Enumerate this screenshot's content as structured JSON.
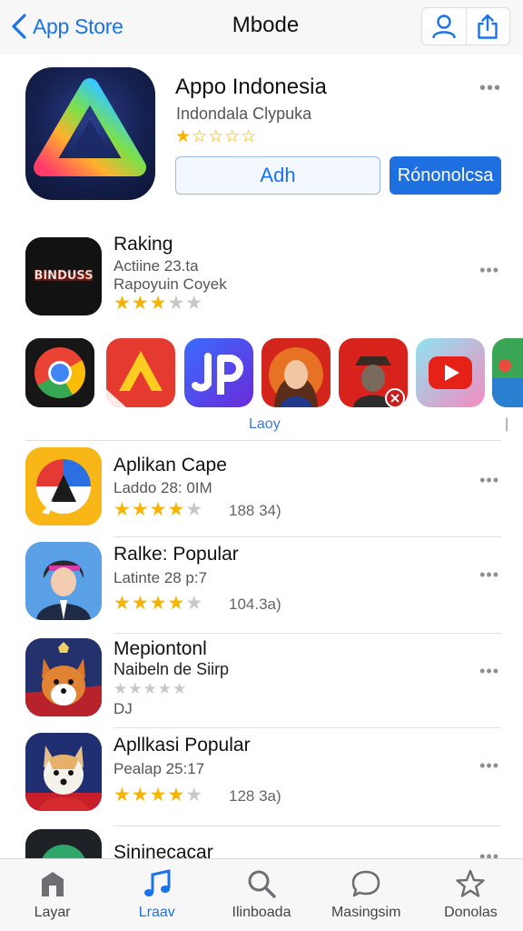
{
  "nav": {
    "back_label": "App Store",
    "title": "Mbode",
    "actions": [
      "account-icon",
      "share-icon"
    ]
  },
  "featured": {
    "name": "Appo Indonesia",
    "subtitle": "Indondala Clypuka",
    "rating": 1,
    "stars_total": 5,
    "stars_text": "★☆☆☆☆",
    "more": "•••",
    "primary_button": "Adh",
    "secondary_button": "Rónonolcsa"
  },
  "ranking": {
    "icon_text": "BINDUSS",
    "name": "Raking",
    "line1": "Actiine 23.ta",
    "line2": "Rapoyuin Coyek",
    "stars_on": "★★★",
    "stars_off": "★★",
    "more": "•••"
  },
  "strip": {
    "label": "Laoy",
    "tick": "|",
    "apps": [
      "chrome-icon",
      "adobe-icon",
      "jp-icon",
      "portrait-icon",
      "detective-icon",
      "youtube-icon",
      "game-icon"
    ]
  },
  "apps": [
    {
      "name": "Aplikan Cape",
      "sub": "Laddo 28: 0IM",
      "stars_on": "★★★★",
      "stars_off": "★",
      "count": "188 34)",
      "more": "•••"
    },
    {
      "name": "Ralke: Popular",
      "sub": "Latinte 28 p:7",
      "stars_on": "★★★★",
      "stars_off": "★",
      "count": "104.3a)",
      "more": "•••"
    },
    {
      "name": "Mepiontonl",
      "sub": "Naibeln de Siirp",
      "stars_on": "",
      "stars_off": "★★★★★",
      "extra": "DJ",
      "more": "•••"
    },
    {
      "name": "Apllkasi Popular",
      "sub": "Pealap 25:17",
      "stars_on": "★★★★",
      "stars_off": "★",
      "count": "128 3a)",
      "more": "•••"
    },
    {
      "name": "Sininecacar",
      "more": "•••"
    }
  ],
  "tabs": [
    {
      "label": "Layar",
      "icon": "home-icon"
    },
    {
      "label": "Lraav",
      "icon": "music-icon"
    },
    {
      "label": "Ilinboada",
      "icon": "search-icon"
    },
    {
      "label": "Masingsim",
      "icon": "chat-icon"
    },
    {
      "label": "Donolas",
      "icon": "star-icon"
    }
  ],
  "colors": {
    "accent": "#1a73e8",
    "star": "#f4b400"
  }
}
